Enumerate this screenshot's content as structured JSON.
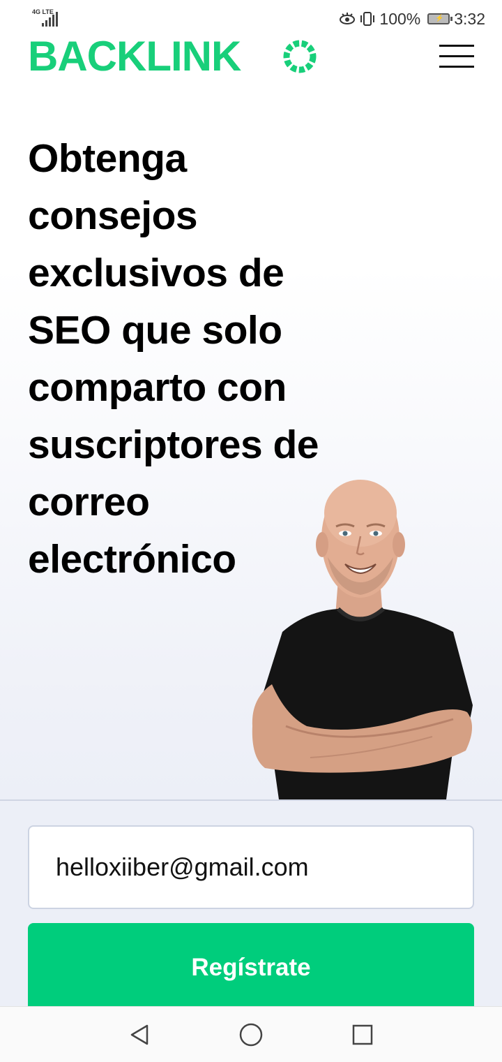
{
  "status_bar": {
    "network": "4G LTE",
    "battery": "100%",
    "time": "3:32"
  },
  "header": {
    "logo_text": "BACKLINK",
    "logo_last_letter": "O",
    "brand_color": "#18cf7a",
    "menu_icon": "hamburger-menu-icon"
  },
  "hero": {
    "title": "Obtenga consejos exclusivos de SEO que solo comparto con suscriptores de correo electrónico"
  },
  "form": {
    "email_value": "helloxiiber@gmail.com",
    "submit_label": "Regístrate",
    "button_color": "#00cd7c"
  },
  "nav_bar": {
    "back_icon": "back-triangle-icon",
    "home_icon": "home-circle-icon",
    "recents_icon": "recents-square-icon"
  }
}
